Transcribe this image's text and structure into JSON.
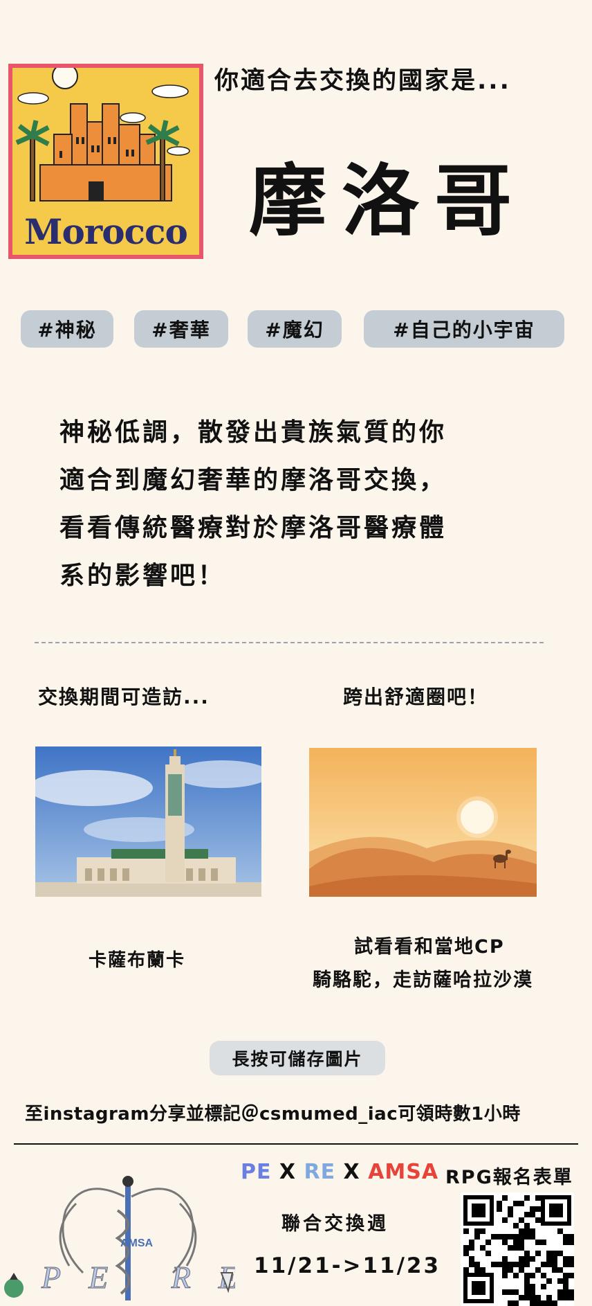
{
  "poster": {
    "word": "Morocco"
  },
  "intro": "你適合去交換的國家是...",
  "country": "摩洛哥",
  "tags": [
    "#神秘",
    "#奢華",
    "#魔幻",
    "#自己的小宇宙"
  ],
  "description": [
    "神秘低調，散發出貴族氣質的你",
    "適合到魔幻奢華的摩洛哥交換，",
    "看看傳統醫療對於摩洛哥醫療體",
    "系的影響吧！"
  ],
  "sections": {
    "visit_heading": "交換期間可造訪...",
    "comfort_heading": "跨出舒適圈吧！",
    "visit_caption": "卡薩布蘭卡",
    "comfort_caption_line1": "試看看和當地CP",
    "comfort_caption_line2": "騎駱駝，走訪薩哈拉沙漠"
  },
  "save_button": "長按可儲存圖片",
  "share_text": "至instagram分享並標記＠csmumed_iac可領時數1小時",
  "footer": {
    "pe": "PE",
    "x1": " X ",
    "re": "RE",
    "x2": " X ",
    "amsa": "AMSA",
    "rpg_label": "RPG報名表單",
    "event_name": "聯合交換週",
    "dates": "11/21->11/23",
    "logo_text": "PE RE",
    "logo_amsa": "AMSA"
  },
  "colors": {
    "background": "#fcf5ec",
    "tag_bg": "#c4cdd3",
    "pe": "#6b7fe0",
    "re": "#7fa9de",
    "amsa": "#e6443a",
    "poster_frame": "#e9566a",
    "poster_word": "#2a2d6e"
  }
}
